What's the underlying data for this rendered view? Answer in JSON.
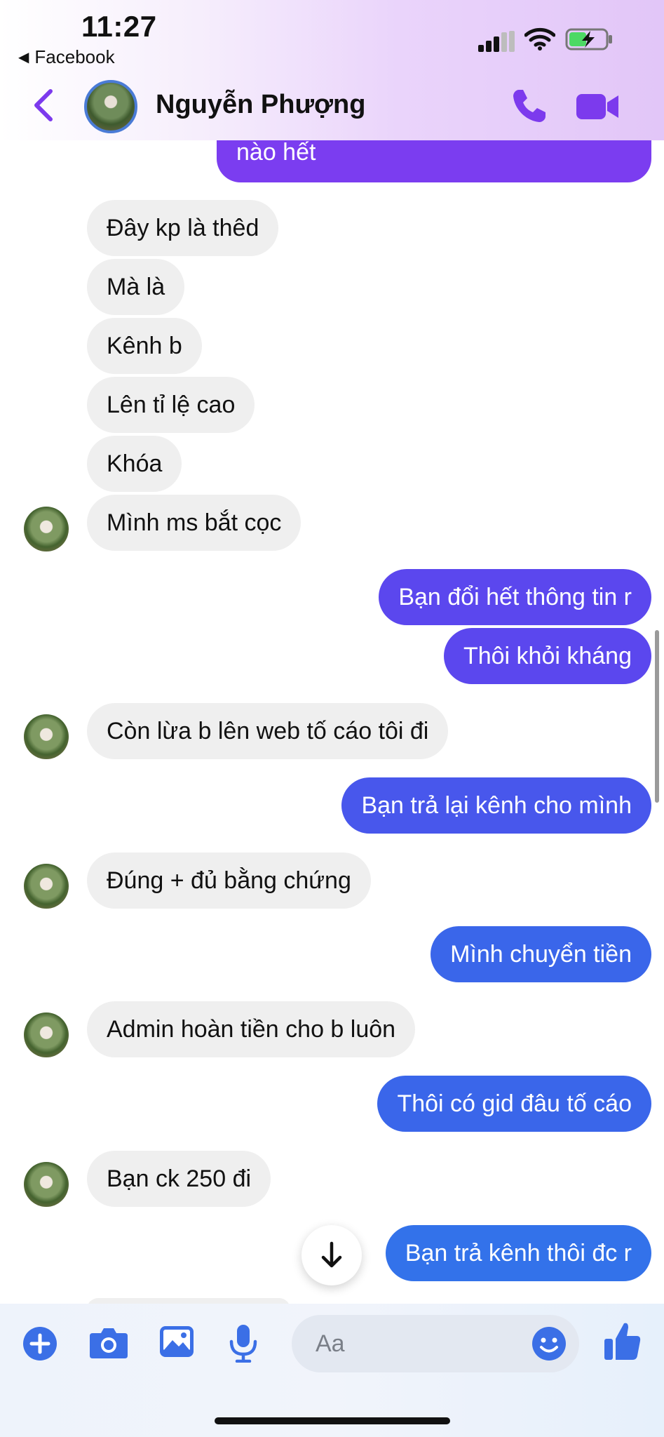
{
  "status_bar": {
    "time": "11:27",
    "back_app": "Facebook"
  },
  "header": {
    "contact_name": "Nguyễn Phượng"
  },
  "messages": [
    {
      "text": "nào hết"
    },
    {
      "text": "Đây kp là thêd"
    },
    {
      "text": "Mà là"
    },
    {
      "text": "Kênh b"
    },
    {
      "text": "Lên tỉ lệ cao"
    },
    {
      "text": "Khóa"
    },
    {
      "text": "Mình ms bắt cọc"
    },
    {
      "text": "Bạn đổi hết thông tin r"
    },
    {
      "text": "Thôi khỏi kháng"
    },
    {
      "text": "Còn lừa b lên web tố cáo tôi đi"
    },
    {
      "text": "Bạn trả lại kênh cho mình"
    },
    {
      "text": "Đúng + đủ bằng chứng"
    },
    {
      "text": "Mình chuyển tiền"
    },
    {
      "text": "Admin hoàn tiền cho b luôn"
    },
    {
      "text": "Thôi có gid đâu tố cáo"
    },
    {
      "text": "Bạn ck 250 đi"
    },
    {
      "text": "Bạn trả kênh thôi đc r"
    }
  ],
  "composer": {
    "placeholder": "Aa"
  },
  "colors": {
    "outgoing_purple": "#7b3df0",
    "outgoing_blue": "#3372ea",
    "incoming_gray": "#efefef",
    "accent": "#7c3aed"
  },
  "icons": [
    "back-chevron-icon",
    "phone-icon",
    "video-icon",
    "plus-icon",
    "camera-icon",
    "gallery-icon",
    "microphone-icon",
    "emoji-icon",
    "thumbs-up-icon",
    "arrow-down-icon"
  ]
}
